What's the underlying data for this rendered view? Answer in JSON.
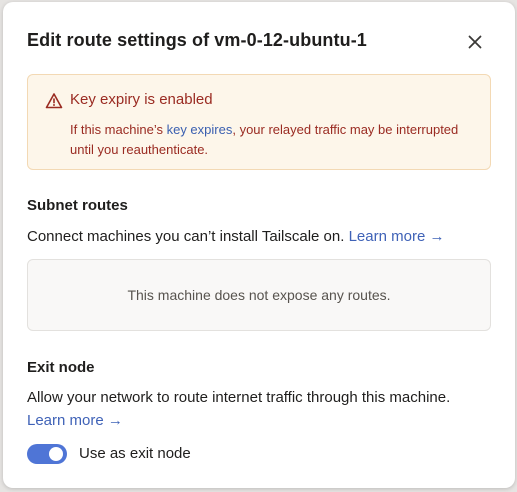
{
  "dialog": {
    "title": "Edit route settings of vm-0-12-ubuntu-1"
  },
  "alert": {
    "title": "Key expiry is enabled",
    "body_before": "If this machine’s ",
    "body_link": "key expires",
    "body_after": ", your relayed traffic may be interrupted until you reauthenticate."
  },
  "subnet_routes": {
    "heading": "Subnet routes",
    "description": "Connect machines you can’t install Tailscale on.",
    "learn_more": "Learn more →",
    "empty_message": "This machine does not expose any routes."
  },
  "exit_node": {
    "heading": "Exit node",
    "description": "Allow your network to route internet traffic through this machine.",
    "learn_more": "Learn more →",
    "toggle_label": "Use as exit node",
    "enabled": true
  },
  "icons": {
    "close": "close-icon",
    "warning": "warning-triangle-icon"
  },
  "colors": {
    "accent": "#4f75d6",
    "link": "#3f62b7",
    "alert_bg": "#fdf6ea",
    "alert_text": "#9a2b22"
  }
}
